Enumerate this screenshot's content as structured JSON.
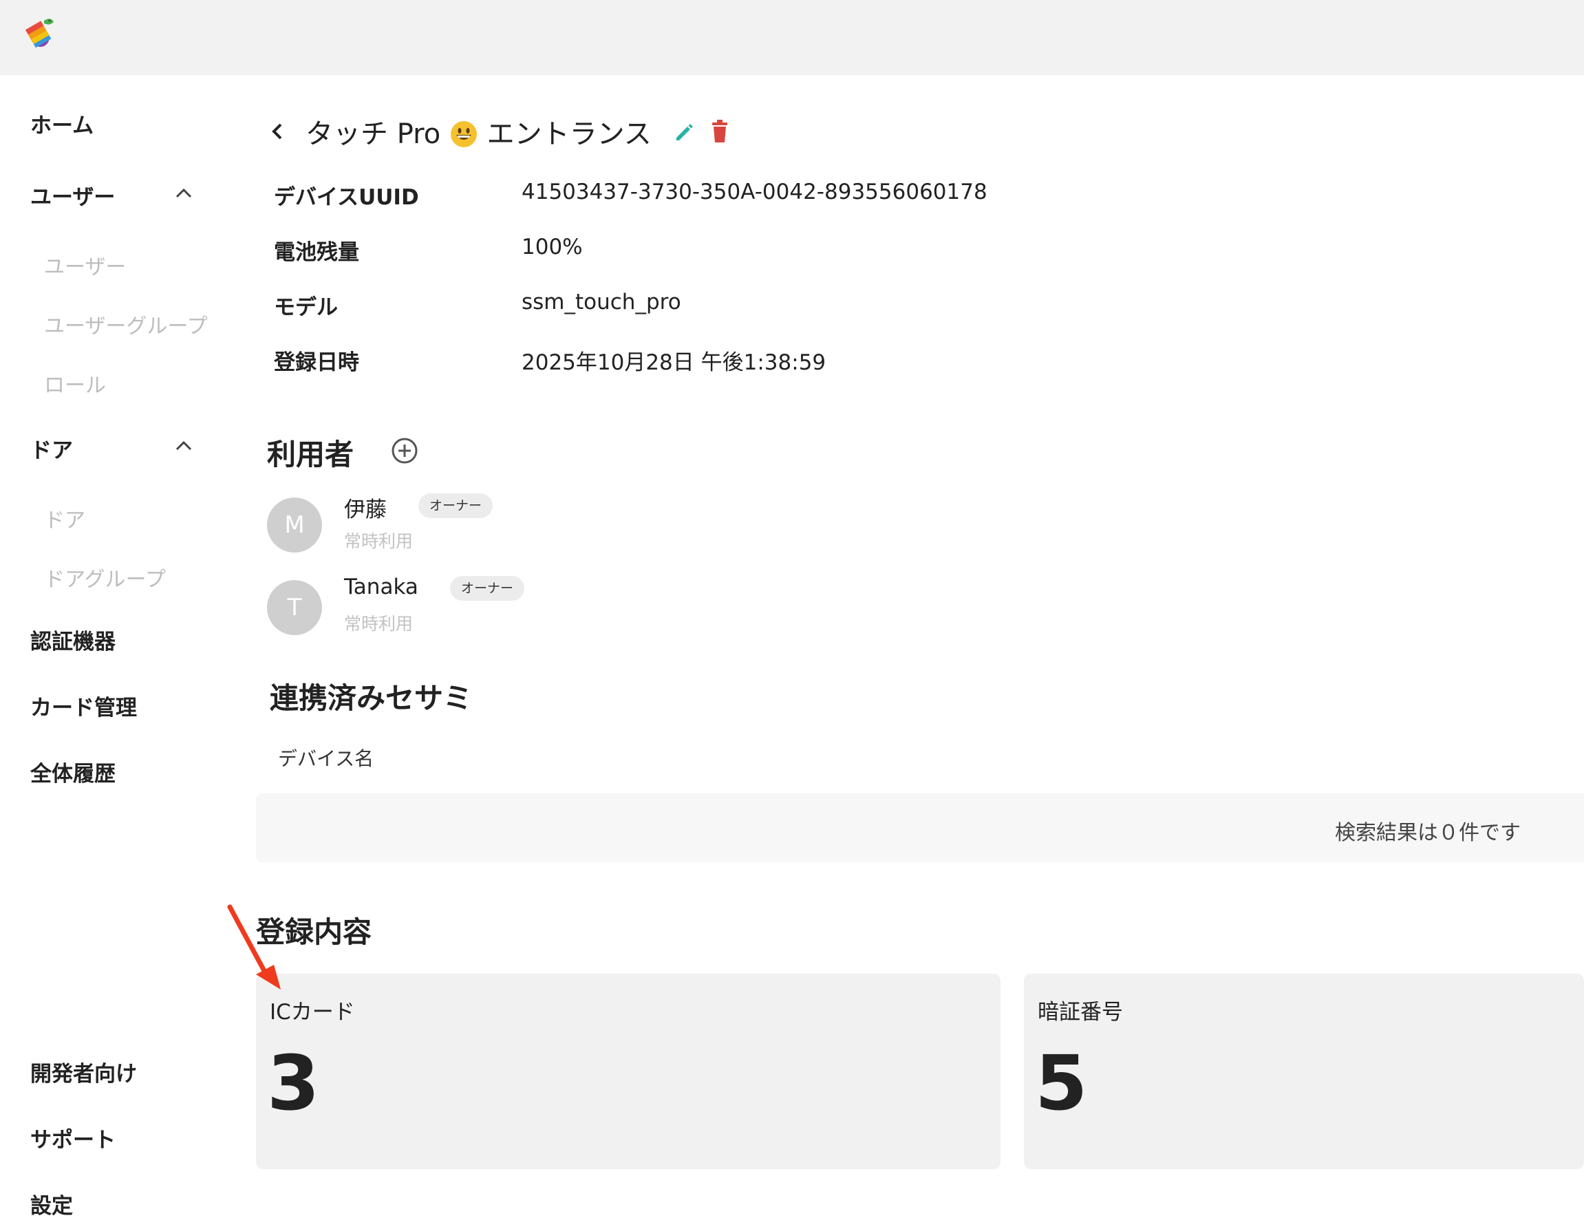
{
  "app": {
    "logo_icon": "colorful-candy-logo"
  },
  "sidebar": {
    "home": "ホーム",
    "users_section": "ユーザー",
    "users_items": [
      "ユーザー",
      "ユーザーグループ",
      "ロール"
    ],
    "doors_section": "ドア",
    "doors_items": [
      "ドア",
      "ドアグループ"
    ],
    "auth_devices": "認証機器",
    "card_management": "カード管理",
    "all_history": "全体履歴",
    "developers": "開発者向け",
    "support": "サポート",
    "settings": "設定"
  },
  "header": {
    "title_part1": "タッチ Pro",
    "title_emoji": "grinning-face-emoji",
    "title_part2": "エントランス"
  },
  "device_info": [
    {
      "label": "デバイスUUID",
      "value": "41503437-3730-350A-0042-893556060178"
    },
    {
      "label": "電池残量",
      "value": "100%"
    },
    {
      "label": "モデル",
      "value": "ssm_touch_pro"
    },
    {
      "label": "登録日時",
      "value": "2025年10月28日 午後1:38:59"
    }
  ],
  "users_section": {
    "title": "利用者",
    "users": [
      {
        "initial": "M",
        "name": "伊藤",
        "role": "オーナー",
        "access": "常時利用"
      },
      {
        "initial": "T",
        "name": "Tanaka",
        "role": "オーナー",
        "access": "常時利用"
      }
    ]
  },
  "linked_section": {
    "title": "連携済みセサミ",
    "column_header": "デバイス名",
    "empty_message": "検索結果は０件です"
  },
  "registered_section": {
    "title": "登録内容",
    "cards": [
      {
        "label": "ICカード",
        "value": "3"
      },
      {
        "label": "暗証番号",
        "value": "5"
      }
    ]
  },
  "colors": {
    "edit_icon": "#2bb3a6",
    "trash_icon": "#d9453d",
    "annotation_arrow": "#f03a1e"
  }
}
